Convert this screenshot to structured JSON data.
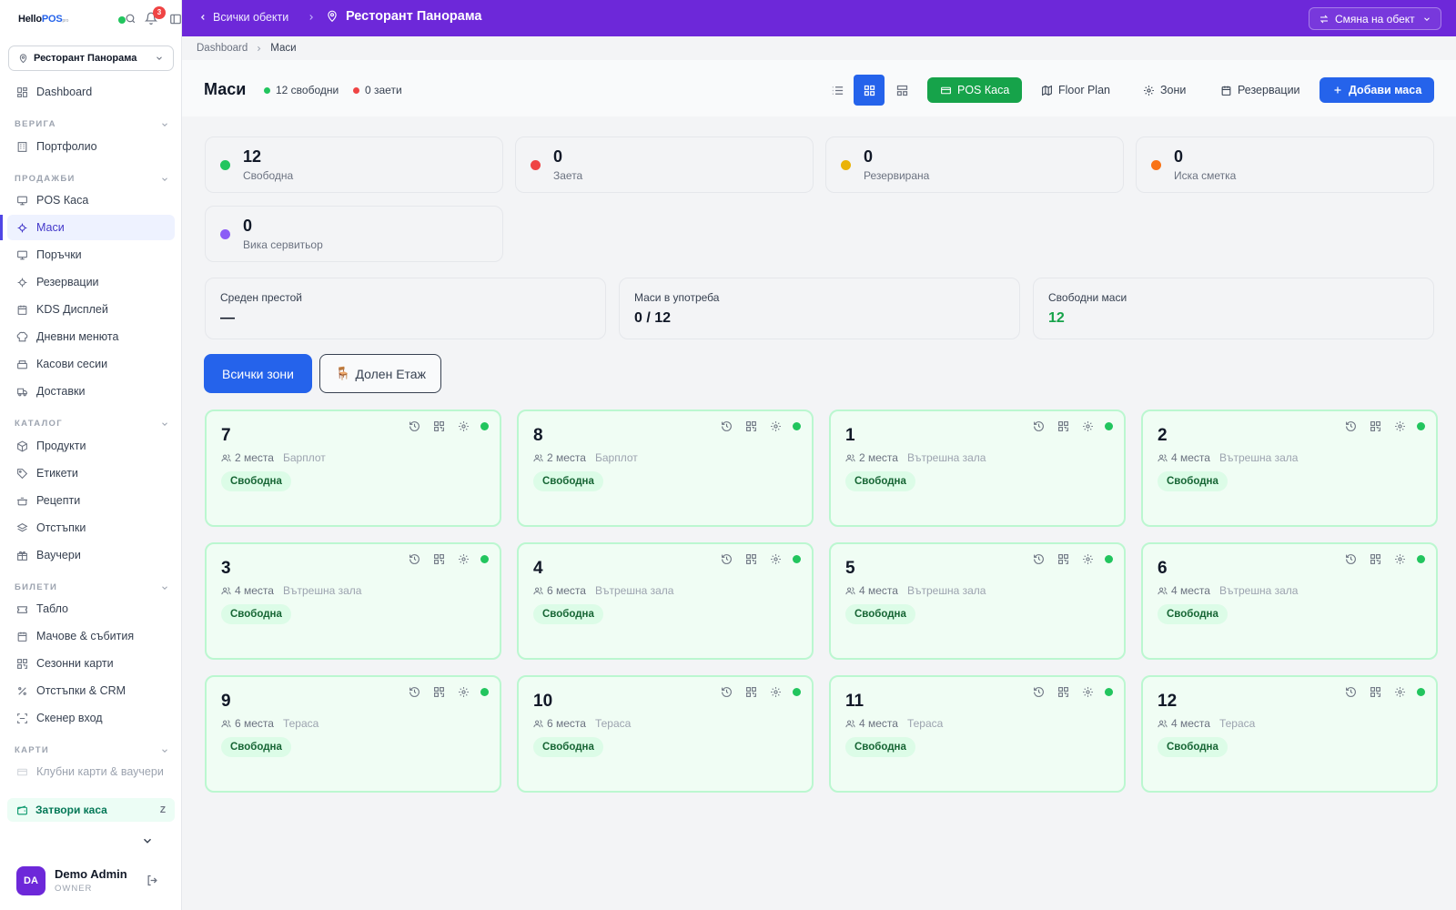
{
  "sidebar": {
    "logo": {
      "main": "Hello",
      "accent": "POS",
      "suffix": "pro"
    },
    "notifications_count": "3",
    "venue_select": "Ресторант Панорама",
    "dashboard": "Dashboard",
    "sections": {
      "chain": "ВЕРИГА",
      "sales": "ПРОДАЖБИ",
      "catalog": "КАТАЛОГ",
      "tickets": "БИЛЕТИ",
      "cards": "КАРТИ"
    },
    "items": {
      "portfolio": "Портфолио",
      "pos": "POS Каса",
      "tables": "Маси",
      "orders": "Поръчки",
      "reservations": "Резервации",
      "kds": "KDS Дисплей",
      "daily_menus": "Дневни менюта",
      "cash_sessions": "Касови сесии",
      "deliveries": "Доставки",
      "products": "Продукти",
      "labels": "Етикети",
      "recipes": "Рецепти",
      "discounts": "Отстъпки",
      "vouchers": "Ваучери",
      "board": "Табло",
      "matches": "Мачове & събития",
      "season_cards": "Сезонни карти",
      "discounts_crm": "Отстъпки & CRM",
      "scanner": "Скенер вход",
      "club_cards": "Клубни карти & ваучери"
    },
    "close_cash": "Затвори каса",
    "close_cash_key": "Z",
    "user": {
      "initials": "DA",
      "name": "Demo Admin",
      "role": "OWNER"
    }
  },
  "topbar": {
    "back": "Всички обекти",
    "venue": "Ресторант Панорама",
    "change_venue": "Смяна на обект"
  },
  "breadcrumb": {
    "root": "Dashboard",
    "current": "Маси"
  },
  "header": {
    "title": "Маси",
    "free": "12 свободни",
    "occupied": "0 заети",
    "pos_button": "POS Каса",
    "floor_plan": "Floor Plan",
    "zones": "Зони",
    "reservations": "Резервации",
    "add_table": "Добави маса"
  },
  "summary": [
    {
      "value": "12",
      "label": "Свободна",
      "color": "#22c55e"
    },
    {
      "value": "0",
      "label": "Заета",
      "color": "#ef4444"
    },
    {
      "value": "0",
      "label": "Резервирана",
      "color": "#eab308"
    },
    {
      "value": "0",
      "label": "Иска сметка",
      "color": "#f97316"
    },
    {
      "value": "0",
      "label": "Вика сервитьор",
      "color": "#8b5cf6"
    }
  ],
  "metrics": [
    {
      "label": "Среден престой",
      "value": "—"
    },
    {
      "label": "Маси в употреба",
      "value": "0 / 12"
    },
    {
      "label": "Свободни маси",
      "value": "12"
    }
  ],
  "zones": {
    "all": "Всички зони",
    "ground_floor": "Долен Етаж",
    "ground_floor_icon": "🪑"
  },
  "tables": [
    {
      "number": "7",
      "seats": "2 места",
      "zone": "Барплот",
      "status": "Свободна"
    },
    {
      "number": "8",
      "seats": "2 места",
      "zone": "Барплот",
      "status": "Свободна"
    },
    {
      "number": "1",
      "seats": "2 места",
      "zone": "Вътрешна зала",
      "status": "Свободна"
    },
    {
      "number": "2",
      "seats": "4 места",
      "zone": "Вътрешна зала",
      "status": "Свободна"
    },
    {
      "number": "3",
      "seats": "4 места",
      "zone": "Вътрешна зала",
      "status": "Свободна"
    },
    {
      "number": "4",
      "seats": "6 места",
      "zone": "Вътрешна зала",
      "status": "Свободна"
    },
    {
      "number": "5",
      "seats": "4 места",
      "zone": "Вътрешна зала",
      "status": "Свободна"
    },
    {
      "number": "6",
      "seats": "4 места",
      "zone": "Вътрешна зала",
      "status": "Свободна"
    },
    {
      "number": "9",
      "seats": "6 места",
      "zone": "Тераса",
      "status": "Свободна"
    },
    {
      "number": "10",
      "seats": "6 места",
      "zone": "Тераса",
      "status": "Свободна"
    },
    {
      "number": "11",
      "seats": "4 места",
      "zone": "Тераса",
      "status": "Свободна"
    },
    {
      "number": "12",
      "seats": "4 места",
      "zone": "Тераса",
      "status": "Свободна"
    }
  ]
}
